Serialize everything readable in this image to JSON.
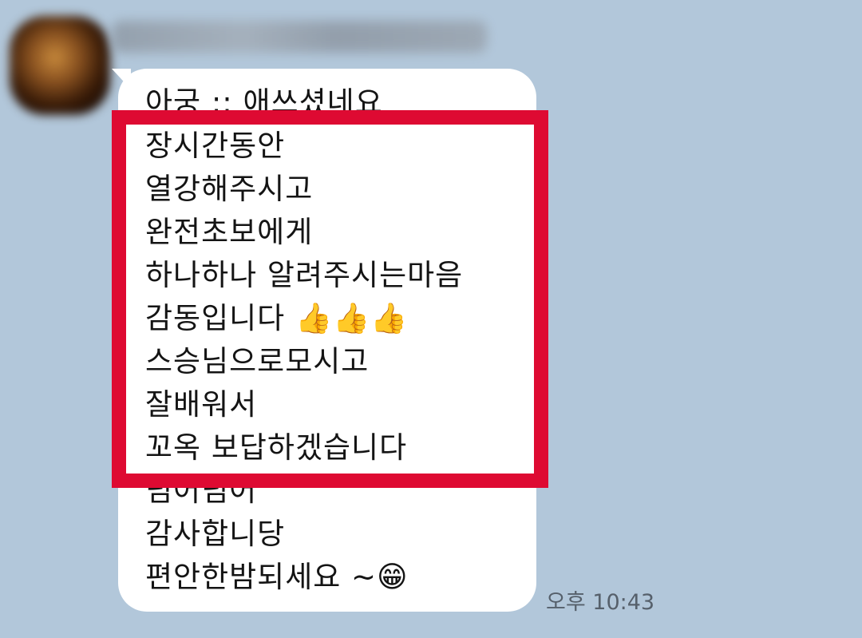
{
  "chat": {
    "sender_name": "",
    "message": {
      "lines": [
        "아궁 ;; 애쓰셨네요",
        "장시간동안",
        "열강해주시고",
        "완전초보에게",
        "하나하나 알려주시는마음",
        "감동입니다 👍👍👍",
        "스승님으로모시고",
        "잘배워서",
        "꼬옥 보답하겠습니다",
        "넘어넘어",
        "감사합니당",
        "편안한밤되세요 ~😁"
      ],
      "time": "오후 10:43"
    }
  },
  "colors": {
    "chat_background": "#b2c7da",
    "bubble": "#ffffff",
    "highlight": "#de0a32",
    "timestamp": "#56606b"
  }
}
